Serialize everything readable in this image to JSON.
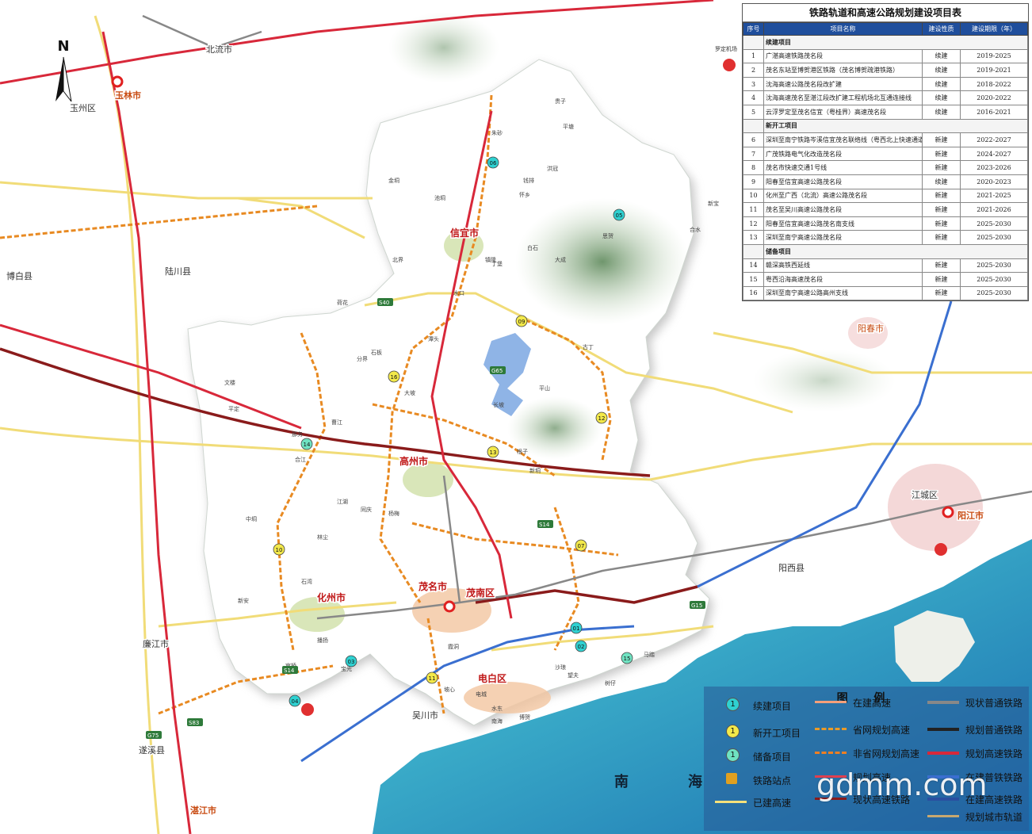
{
  "table": {
    "title": "铁路轨道和高速公路规划建设项目表",
    "headers": [
      "序号",
      "项目名称",
      "建设性质",
      "建设期限（年）"
    ],
    "sections": [
      {
        "name": "续建项目",
        "rows": [
          {
            "no": "1",
            "name": "广湛高速铁路茂名段",
            "type": "续建",
            "period": "2019-2025"
          },
          {
            "no": "2",
            "name": "茂名东站至博贺港区铁路（茂名博贺疏港铁路）",
            "type": "续建",
            "period": "2019-2021"
          },
          {
            "no": "3",
            "name": "沈海高速公路茂名段改扩建",
            "type": "续建",
            "period": "2018-2022"
          },
          {
            "no": "4",
            "name": "沈海高速茂名至湛江段改扩建工程机场北互通连接线",
            "type": "续建",
            "period": "2020-2022"
          },
          {
            "no": "5",
            "name": "云浮罗定至茂名信宜（粤桂界）高速茂名段",
            "type": "续建",
            "period": "2016-2021"
          }
        ]
      },
      {
        "name": "新开工项目",
        "rows": [
          {
            "no": "6",
            "name": "深圳至南宁铁路岑溪信宜茂名联络线（粤西北上快速通道）",
            "type": "新建",
            "period": "2022-2027"
          },
          {
            "no": "7",
            "name": "广茂铁路电气化改造茂名段",
            "type": "新建",
            "period": "2024-2027"
          },
          {
            "no": "8",
            "name": "茂名市快速交通1号线",
            "type": "新建",
            "period": "2023-2026"
          },
          {
            "no": "9",
            "name": "阳春至信宜高速公路茂名段",
            "type": "续建",
            "period": "2020-2023"
          },
          {
            "no": "10",
            "name": "化州至广西（北流）高速公路茂名段",
            "type": "新建",
            "period": "2021-2025"
          },
          {
            "no": "11",
            "name": "茂名至吴川高速公路茂名段",
            "type": "新建",
            "period": "2021-2026"
          },
          {
            "no": "12",
            "name": "阳春至信宜高速公路茂名南支线",
            "type": "新建",
            "period": "2025-2030"
          },
          {
            "no": "13",
            "name": "深圳至南宁高速公路茂名段",
            "type": "新建",
            "period": "2025-2030"
          }
        ]
      },
      {
        "name": "储备项目",
        "rows": [
          {
            "no": "14",
            "name": "赣深高铁西延线",
            "type": "新建",
            "period": "2025-2030"
          },
          {
            "no": "15",
            "name": "粤西沿海高速茂名段",
            "type": "新建",
            "period": "2025-2030"
          },
          {
            "no": "16",
            "name": "深圳至南宁高速公路高州支线",
            "type": "新建",
            "period": "2025-2030"
          }
        ]
      }
    ]
  },
  "legend": {
    "title": "图 例",
    "items": [
      {
        "label": "续建项目",
        "kind": "badge",
        "color": "#2fd1d1",
        "text": "1"
      },
      {
        "label": "新开工项目",
        "kind": "badge",
        "color": "#f3e94a",
        "text": "1"
      },
      {
        "label": "储备项目",
        "kind": "badge",
        "color": "#6fe3c2",
        "text": "1"
      },
      {
        "label": "铁路站点",
        "kind": "station",
        "color": "#e0a020"
      },
      {
        "label": "已建高速",
        "kind": "line",
        "color": "#f5e07a"
      },
      {
        "label": "在建高速",
        "kind": "line",
        "color": "#f4a07a"
      },
      {
        "label": "省网规划高速",
        "kind": "dash",
        "color": "#e89a28"
      },
      {
        "label": "非省网规划高速",
        "kind": "dash",
        "color": "#ef7f22"
      },
      {
        "label": "规划高速",
        "kind": "line",
        "color": "#e04050"
      },
      {
        "label": "现状高速铁路",
        "kind": "line",
        "color": "#8a1b1b"
      },
      {
        "label": "现状普通铁路",
        "kind": "rail",
        "color": "#888888"
      },
      {
        "label": "规划普通铁路",
        "kind": "rail",
        "color": "#222222"
      },
      {
        "label": "规划高速铁路",
        "kind": "rail",
        "color": "#d8283a"
      },
      {
        "label": "在建普铁铁路",
        "kind": "rail",
        "color": "#3a6fd0"
      },
      {
        "label": "在建高速铁路",
        "kind": "rail",
        "color": "#2a4fa0"
      },
      {
        "label": "规划城市轨道",
        "kind": "line",
        "color": "#c8a870"
      }
    ]
  },
  "places": {
    "cities_major": [
      "茂名市",
      "化州市",
      "信宜市",
      "高州市",
      "电白区",
      "茂南区"
    ],
    "cities_other": [
      "玉林市",
      "阳春市",
      "阳江市",
      "江城区",
      "吴川市",
      "湛江市",
      "廉江市",
      "遂溪县",
      "博白县",
      "陆川县",
      "北流市",
      "玉州区",
      "阳西县"
    ],
    "sea": [
      "南",
      "海"
    ],
    "airport": "罗定机场",
    "towns": [
      "朱砂",
      "金垌",
      "池垌",
      "钱排",
      "洪冠",
      "平塘",
      "合水",
      "怀乡",
      "镇隆",
      "白石",
      "大成",
      "贵子",
      "北界",
      "丁堡",
      "水口",
      "荷花",
      "新宝",
      "思贺",
      "石板",
      "分界",
      "潭头",
      "大坡",
      "曹江",
      "根子",
      "平山",
      "古丁",
      "文楼",
      "平定",
      "那务",
      "合江",
      "石湾",
      "长坡",
      "新垌",
      "中垌",
      "江湖",
      "同庆",
      "杨梅",
      "林尘",
      "新安",
      "官桥",
      "播扬",
      "宝光",
      "霞洞",
      "沙琅",
      "望夫",
      "马踏",
      "树仔",
      "博贺",
      "水东",
      "南海",
      "坡心",
      "电城"
    ]
  },
  "route_badges": [
    "06",
    "05",
    "09",
    "16",
    "12",
    "13",
    "14",
    "10",
    "07",
    "01",
    "02",
    "15",
    "03",
    "04",
    "11"
  ],
  "route_codes": [
    "S40",
    "G65",
    "S14",
    "G15",
    "S14",
    "S83",
    "G75"
  ],
  "north": "N",
  "watermark": "gdmm.com"
}
